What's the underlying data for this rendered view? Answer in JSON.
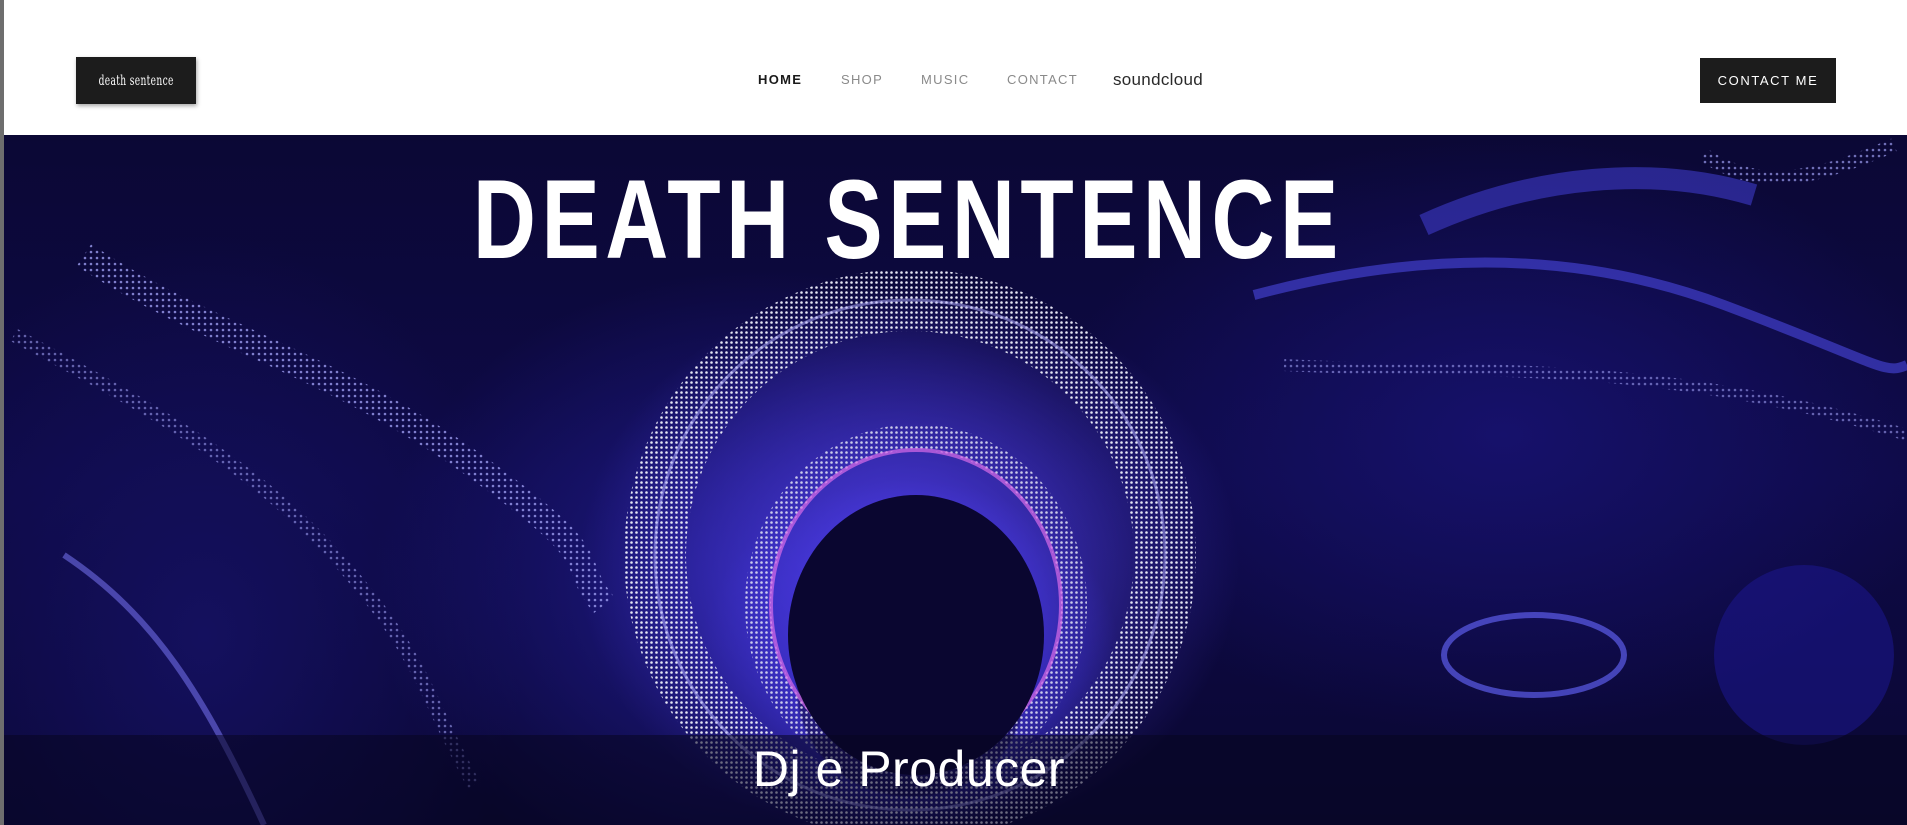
{
  "header": {
    "logo_text": "death sentence",
    "nav": [
      {
        "label": "HOME",
        "active": true
      },
      {
        "label": "SHOP",
        "active": false
      },
      {
        "label": "MUSIC",
        "active": false
      },
      {
        "label": "CONTACT",
        "active": false
      },
      {
        "label": "soundcloud",
        "active": false
      }
    ],
    "cta_label": "CONTACT ME"
  },
  "hero": {
    "title": "DEATH SENTENCE",
    "subtitle": "Dj e Producer"
  },
  "colors": {
    "header_bg": "#ffffff",
    "button_bg": "#1c1c1c",
    "hero_bg": "#0e0a47",
    "hero_accent": "#3a2fd0"
  }
}
